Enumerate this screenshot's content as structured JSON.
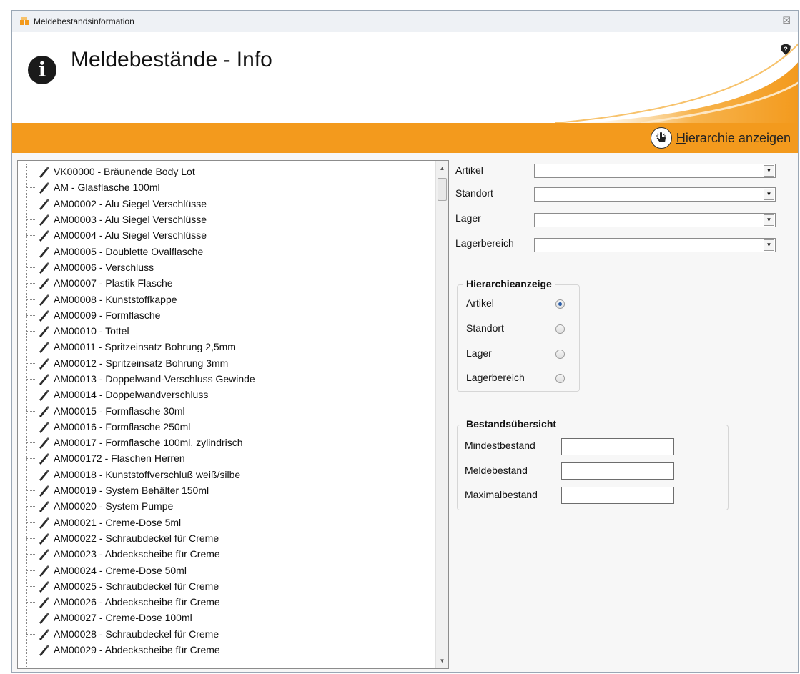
{
  "window": {
    "title": "Meldebestandsinformation",
    "close_glyph": "☒"
  },
  "header": {
    "title": "Meldebestände - Info",
    "info_glyph": "i"
  },
  "toolbar": {
    "hierarchy_button": "Hierarchie anzeigen"
  },
  "tree": {
    "items": [
      "VK00000 - Bräunende Body Lot",
      "AM - Glasflasche 100ml",
      "AM00002 - Alu Siegel Verschlüsse",
      "AM00003 - Alu Siegel Verschlüsse",
      "AM00004 - Alu Siegel Verschlüsse",
      "AM00005 - Doublette Ovalflasche",
      "AM00006 - Verschluss",
      "AM00007 - Plastik Flasche",
      "AM00008 - Kunststoffkappe",
      "AM00009 - Formflasche",
      "AM00010 - Tottel",
      "AM00011 - Spritzeinsatz Bohrung 2,5mm",
      "AM00012 - Spritzeinsatz Bohrung 3mm",
      "AM00013 - Doppelwand-Verschluss Gewinde",
      "AM00014 - Doppelwandverschluss",
      "AM00015 - Formflasche 30ml",
      "AM00016 - Formflasche 250ml",
      "AM00017 - Formflasche 100ml, zylindrisch",
      "AM000172 - Flaschen Herren",
      "AM00018 - Kunststoffverschluß weiß/silbe",
      "AM00019 - System Behälter 150ml",
      "AM00020 - System Pumpe",
      "AM00021 - Creme-Dose 5ml",
      "AM00022 - Schraubdeckel für Creme",
      "AM00023 - Abdeckscheibe für Creme",
      "AM00024 - Creme-Dose 50ml",
      "AM00025 - Schraubdeckel für Creme",
      "AM00026 - Abdeckscheibe für Creme",
      "AM00027 - Creme-Dose 100ml",
      "AM00028 - Schraubdeckel für Creme",
      "AM00029 - Abdeckscheibe für Creme"
    ]
  },
  "filters": {
    "artikel": {
      "label": "Artikel",
      "value": ""
    },
    "standort": {
      "label": "Standort",
      "value": ""
    },
    "lager": {
      "label": "Lager",
      "value": ""
    },
    "lagerbereich": {
      "label": "Lagerbereich",
      "value": ""
    }
  },
  "hierarchy_group": {
    "title": "Hierarchieanzeige",
    "options": [
      "Artikel",
      "Standort",
      "Lager",
      "Lagerbereich"
    ],
    "selected": "Artikel"
  },
  "stock_group": {
    "title": "Bestandsübersicht",
    "mindest_label": "Mindestbestand",
    "melde_label": "Meldebestand",
    "maximal_label": "Maximalbestand",
    "mindest_value": "",
    "melde_value": "",
    "maximal_value": ""
  },
  "colors": {
    "accent": "#f39a1d",
    "radio_selected": "#2d5fa8"
  }
}
